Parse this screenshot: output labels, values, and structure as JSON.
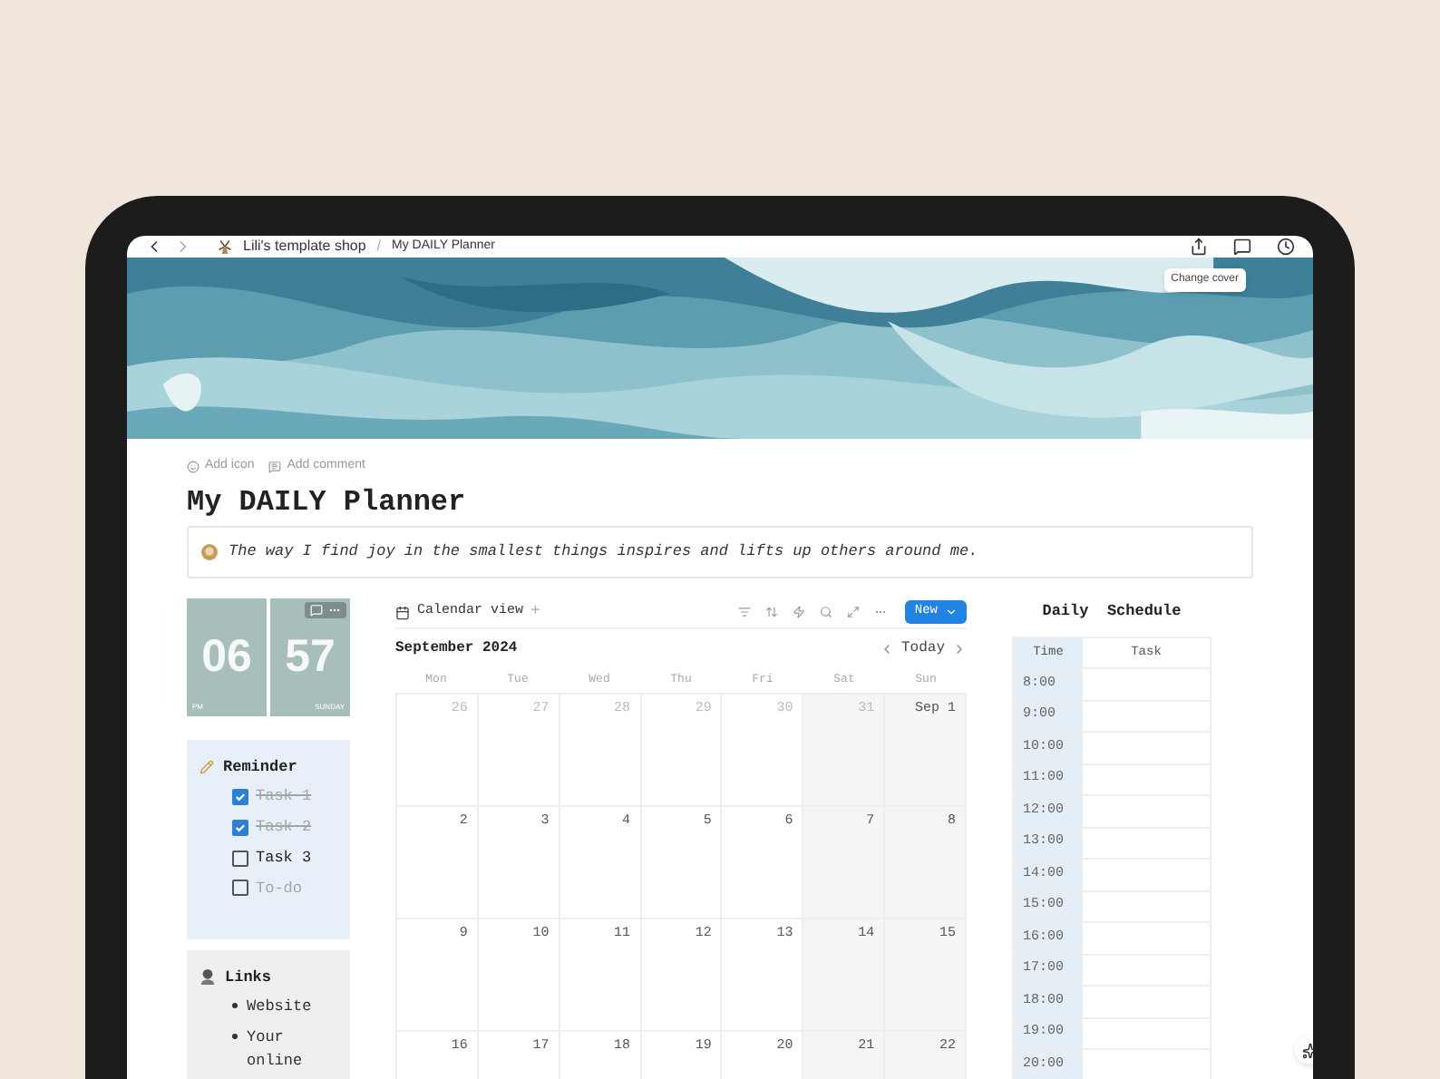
{
  "breadcrumbs": [
    {
      "label": "Lili's template shop"
    },
    {
      "label": "My DAILY Planner"
    }
  ],
  "breadcrumb_separator": "/",
  "cover": {
    "kind": "picture",
    "button": "Change cover"
  },
  "page_actions": [
    "Add icon",
    "Add comment"
  ],
  "title": "My DAILY Planner",
  "quote": "The way I find joy in the smallest things inspires and lifts up others around me.",
  "clock": {
    "hour": "06",
    "minute": "57",
    "period": "PM",
    "day": "SUNDAY"
  },
  "reminder": {
    "title": "Reminder",
    "items": [
      {
        "label": "Task 1",
        "checked": true,
        "empty": false
      },
      {
        "label": "Task 2",
        "checked": true,
        "empty": false
      },
      {
        "label": "Task 3",
        "checked": false,
        "empty": false
      },
      {
        "label": "To-do",
        "checked": false,
        "empty": true
      }
    ]
  },
  "links": {
    "title": "Links",
    "items": [
      "Website",
      "Your online"
    ]
  },
  "calendar": {
    "view": "Calendar view",
    "add": "+",
    "new_button": "New",
    "month": "September 2024",
    "today": "Today",
    "weekdays": [
      "Mon",
      "Tue",
      "Wed",
      "Thu",
      "Fri",
      "Sat",
      "Sun"
    ],
    "weeks": [
      [
        {
          "day": "26",
          "in_month": false
        },
        {
          "day": "27",
          "in_month": false
        },
        {
          "day": "28",
          "in_month": false
        },
        {
          "day": "29",
          "in_month": false
        },
        {
          "day": "30",
          "in_month": false
        },
        {
          "day": "31",
          "in_month": false
        },
        {
          "day": "Sep 1",
          "in_month": true
        }
      ],
      [
        {
          "day": "2",
          "in_month": true
        },
        {
          "day": "3",
          "in_month": true
        },
        {
          "day": "4",
          "in_month": true
        },
        {
          "day": "5",
          "in_month": true
        },
        {
          "day": "6",
          "in_month": true
        },
        {
          "day": "7",
          "in_month": true
        },
        {
          "day": "8",
          "in_month": true
        }
      ],
      [
        {
          "day": "9",
          "in_month": true
        },
        {
          "day": "10",
          "in_month": true
        },
        {
          "day": "11",
          "in_month": true
        },
        {
          "day": "12",
          "in_month": true
        },
        {
          "day": "13",
          "in_month": true
        },
        {
          "day": "14",
          "in_month": true
        },
        {
          "day": "15",
          "in_month": true
        }
      ],
      [
        {
          "day": "16",
          "in_month": true
        },
        {
          "day": "17",
          "in_month": true
        },
        {
          "day": "18",
          "in_month": true
        },
        {
          "day": "19",
          "in_month": true
        },
        {
          "day": "20",
          "in_month": true
        },
        {
          "day": "21",
          "in_month": true
        },
        {
          "day": "22",
          "in_month": true
        }
      ]
    ]
  },
  "schedule": {
    "title": "Daily Schedule",
    "columns": [
      "Time",
      "Task"
    ],
    "rows": [
      "8:00",
      "9:00",
      "10:00",
      "11:00",
      "12:00",
      "13:00",
      "14:00",
      "15:00",
      "16:00",
      "17:00",
      "18:00",
      "19:00",
      "20:00"
    ]
  }
}
